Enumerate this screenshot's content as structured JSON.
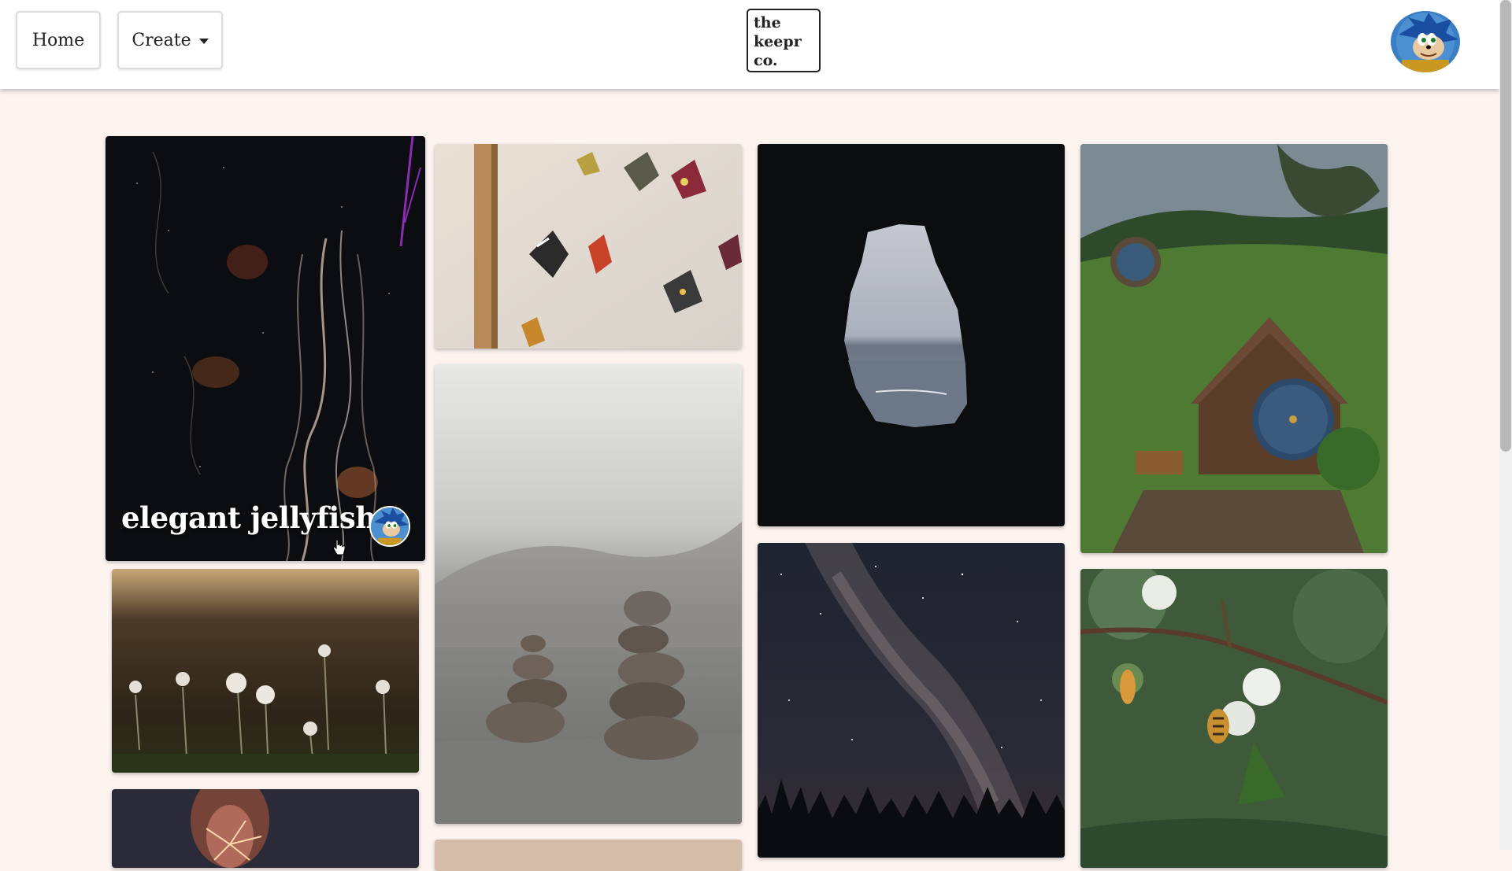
{
  "nav": {
    "home_label": "Home",
    "create_label": "Create",
    "logo_lines": [
      "the",
      "keepr",
      "co."
    ],
    "avatar_icon": "sonic-avatar-icon"
  },
  "cards": [
    {
      "id": "jellyfish",
      "title": "elegant jellyfish",
      "image": "jellyfish-photo",
      "hovered": true
    },
    {
      "id": "butterflies",
      "image": "butterflies-photo"
    },
    {
      "id": "cave-ocean",
      "image": "cave-ocean-photo"
    },
    {
      "id": "hobbit-house",
      "image": "hobbit-house-photo"
    },
    {
      "id": "dandelions",
      "image": "dandelions-photo"
    },
    {
      "id": "stacked-rocks",
      "image": "stacked-rocks-photo"
    },
    {
      "id": "milky-way",
      "image": "milky-way-photo"
    },
    {
      "id": "bee-flower",
      "image": "bee-flower-photo"
    },
    {
      "id": "sparkler",
      "image": "sparkler-photo"
    },
    {
      "id": "partial-tan",
      "image": "partial-photo"
    }
  ],
  "colors": {
    "page_bg": "#fdf4f0",
    "navbar_bg": "#ffffff",
    "text": "#222222"
  }
}
